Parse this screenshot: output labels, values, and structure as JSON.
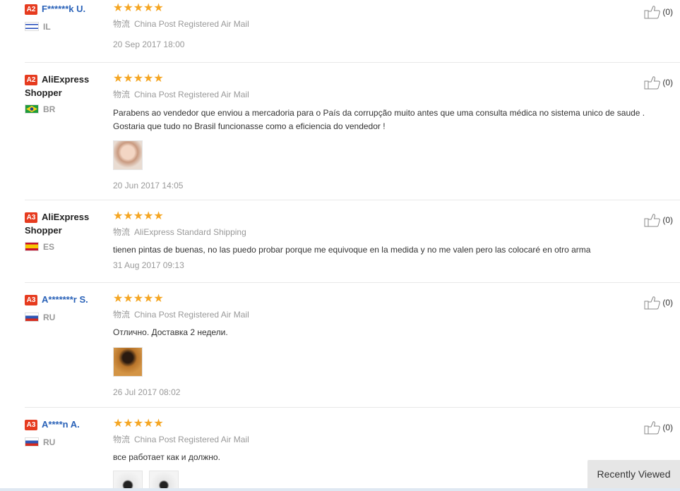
{
  "reviews": [
    {
      "level": "A2",
      "name": "F******k U.",
      "country": "IL",
      "stars": "★★★★★",
      "logistics_label": "物流",
      "logistics": "China Post Registered Air Mail",
      "text": "",
      "date": "20 Sep 2017 18:00",
      "helpful": "(0)"
    },
    {
      "level": "A2",
      "name": "AliExpress Shopper",
      "country": "BR",
      "stars": "★★★★★",
      "logistics_label": "物流",
      "logistics": "China Post Registered Air Mail",
      "text": "Parabens ao vendedor que enviou a mercadoria para o País da corrupção muito antes que uma consulta médica no sistema unico de saude . Gostaria que tudo no Brasil funcionasse como a eficiencia do vendedor !",
      "date": "20 Jun 2017 14:05",
      "helpful": "(0)"
    },
    {
      "level": "A3",
      "name": "AliExpress Shopper",
      "country": "ES",
      "stars": "★★★★★",
      "logistics_label": "物流",
      "logistics": "AliExpress Standard Shipping",
      "text": "tienen pintas de buenas, no las puedo probar porque me equivoque en la medida y no me valen pero las colocaré en otro arma",
      "date": "31 Aug 2017 09:13",
      "helpful": "(0)"
    },
    {
      "level": "A3",
      "name": "A*******r S.",
      "country": "RU",
      "stars": "★★★★★",
      "logistics_label": "物流",
      "logistics": "China Post Registered Air Mail",
      "text": "Отлично. Доставка 2 недели.",
      "date": "26 Jul 2017 08:02",
      "helpful": "(0)"
    },
    {
      "level": "A3",
      "name": "A****n A.",
      "country": "RU",
      "stars": "★★★★★",
      "logistics_label": "物流",
      "logistics": "China Post Registered Air Mail",
      "text": "все работает как и должно.",
      "date": "",
      "helpful": "(0)"
    }
  ],
  "recently_viewed": "Recently Viewed"
}
